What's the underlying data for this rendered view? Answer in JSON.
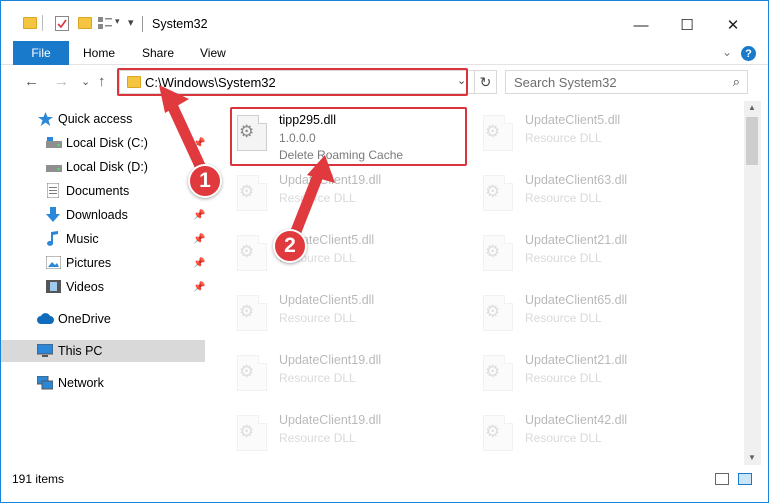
{
  "window": {
    "title": "System32",
    "controls": {
      "minimize": "—",
      "maximize": "☐",
      "close": "✕"
    }
  },
  "ribbon": {
    "tabs": [
      "File",
      "Home",
      "Share",
      "View"
    ],
    "expand": "⌄",
    "help": "?"
  },
  "navigation": {
    "back": "←",
    "forward": "→",
    "recent": "⌄",
    "up": "↑",
    "address": "C:\\Windows\\System32",
    "dropdown": "⌄",
    "refresh": "↻",
    "search_placeholder": "Search System32",
    "search_icon": "⌕"
  },
  "sidebar": {
    "items": [
      {
        "label": "Quick access",
        "icon": "star-icon"
      },
      {
        "label": "Local Disk (C:)",
        "icon": "drive-icon"
      },
      {
        "label": "Local Disk (D:)",
        "icon": "drive-icon"
      },
      {
        "label": "Documents",
        "icon": "documents-icon"
      },
      {
        "label": "Downloads",
        "icon": "download-icon"
      },
      {
        "label": "Music",
        "icon": "music-icon"
      },
      {
        "label": "Pictures",
        "icon": "pictures-icon"
      },
      {
        "label": "Videos",
        "icon": "videos-icon"
      },
      {
        "label": "OneDrive",
        "icon": "cloud-icon"
      },
      {
        "label": "This PC",
        "icon": "computer-icon"
      },
      {
        "label": "Network",
        "icon": "network-icon"
      }
    ]
  },
  "files": {
    "highlighted": {
      "name": "tipp295.dll",
      "version": "1.0.0.0",
      "description": "Delete Roaming Cache"
    },
    "left_column": [
      {
        "name": "UpdateClient19.dll",
        "type": "Resource DLL"
      },
      {
        "name": "UpdateClient5.dll",
        "type": "Resource DLL"
      },
      {
        "name": "UpdateClient5.dll",
        "type": "Resource DLL"
      },
      {
        "name": "UpdateClient19.dll",
        "type": "Resource DLL"
      },
      {
        "name": "UpdateClient19.dll",
        "type": "Resource DLL"
      }
    ],
    "right_column": [
      {
        "name": "UpdateClient5.dll",
        "type": "Resource DLL"
      },
      {
        "name": "UpdateClient63.dll",
        "type": "Resource DLL"
      },
      {
        "name": "UpdateClient21.dll",
        "type": "Resource DLL"
      },
      {
        "name": "UpdateClient65.dll",
        "type": "Resource DLL"
      },
      {
        "name": "UpdateClient21.dll",
        "type": "Resource DLL"
      },
      {
        "name": "UpdateClient42.dll",
        "type": "Resource DLL"
      }
    ]
  },
  "status": {
    "item_count": "191 items"
  },
  "annotations": {
    "step1": "1",
    "step2": "2"
  },
  "colors": {
    "accent": "#1979ca",
    "highlight": "#d9343c",
    "badge": "#e0393e"
  }
}
